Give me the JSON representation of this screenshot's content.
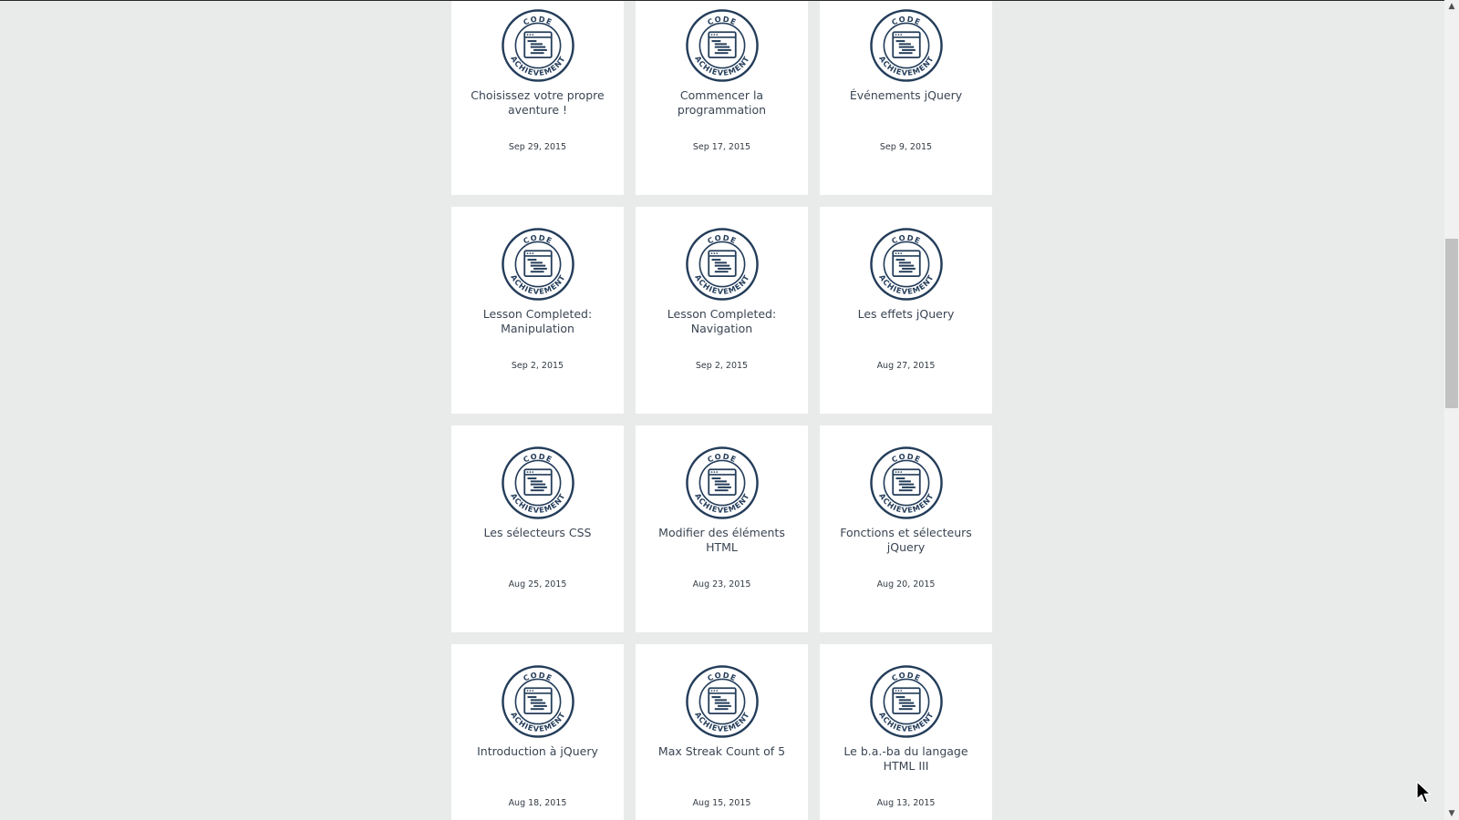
{
  "badge": {
    "top_text": "CODE",
    "bottom_text": "ACHIEVEMENT",
    "icon": "code-achievement-badge-icon",
    "color": "#243d5a"
  },
  "achievements": [
    {
      "title": "Choisissez votre propre aventure !",
      "date": "Sep 29, 2015"
    },
    {
      "title": "Commencer la programmation",
      "date": "Sep 17, 2015"
    },
    {
      "title": "Événements jQuery",
      "date": "Sep 9, 2015"
    },
    {
      "title": "Lesson Completed: Manipulation",
      "date": "Sep 2, 2015"
    },
    {
      "title": "Lesson Completed: Navigation",
      "date": "Sep 2, 2015"
    },
    {
      "title": "Les effets jQuery",
      "date": "Aug 27, 2015"
    },
    {
      "title": "Les sélecteurs CSS",
      "date": "Aug 25, 2015"
    },
    {
      "title": "Modifier des éléments HTML",
      "date": "Aug 23, 2015"
    },
    {
      "title": "Fonctions et sélecteurs jQuery",
      "date": "Aug 20, 2015"
    },
    {
      "title": "Introduction à jQuery",
      "date": "Aug 18, 2015"
    },
    {
      "title": "Max Streak Count of 5",
      "date": "Aug 15, 2015"
    },
    {
      "title": "Le b.a.-ba du langage HTML III",
      "date": "Aug 13, 2015"
    }
  ],
  "scrollbar": {
    "up_icon": "scroll-up-arrow-icon",
    "down_icon": "scroll-down-arrow-icon"
  },
  "colors": {
    "background": "#e9ebea",
    "card": "#ffffff",
    "title_text": "#3a4553"
  }
}
